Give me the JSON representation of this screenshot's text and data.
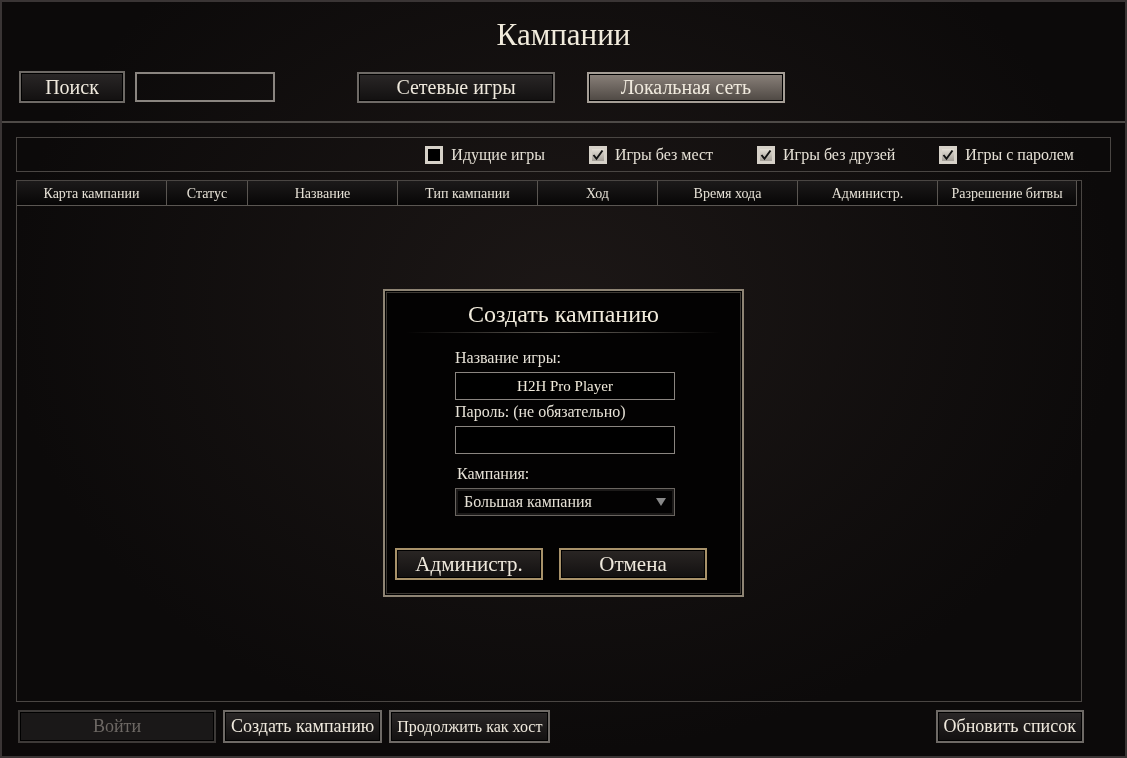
{
  "title": "Кампании",
  "search": {
    "button": "Поиск"
  },
  "tabs": [
    {
      "label": "Сетевые игры",
      "selected": false
    },
    {
      "label": "Локальная сеть",
      "selected": true
    }
  ],
  "filters": [
    {
      "label": "Идущие игры",
      "checked": false
    },
    {
      "label": "Игры без мест",
      "checked": true
    },
    {
      "label": "Игры без друзей",
      "checked": true
    },
    {
      "label": "Игры с паролем",
      "checked": true
    }
  ],
  "table": {
    "columns": [
      "Карта кампании",
      "Статус",
      "Название",
      "Тип кампании",
      "Ход",
      "Время хода",
      "Администр.",
      "Разрешение битвы"
    ]
  },
  "dialog": {
    "title": "Создать кампанию",
    "fields": [
      {
        "label": "Название игры:",
        "value": "H2H Pro Player"
      },
      {
        "label": "Пароль: (не обязательно)"
      }
    ],
    "campaign": {
      "label": "Кампания:",
      "value": "Большая кампания"
    },
    "buttons": [
      "Администр.",
      "Отмена"
    ]
  },
  "bottom_buttons": [
    {
      "label": "Войти",
      "disabled": true
    },
    {
      "label": "Создать кампанию",
      "disabled": false
    },
    {
      "label": "Продолжить как хост",
      "disabled": false
    },
    {
      "label": "Обновить список",
      "disabled": false
    }
  ]
}
